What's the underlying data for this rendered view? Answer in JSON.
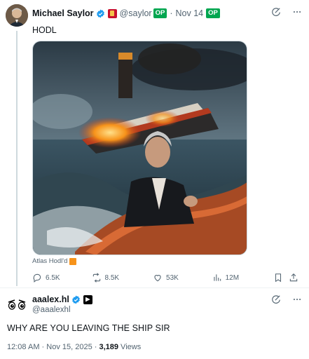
{
  "tweet1": {
    "author_name": "Michael Saylor",
    "handle": "@saylor",
    "op_badge": "OP",
    "date": "Nov 14",
    "date_op_badge": "OP",
    "text": "HODL",
    "media_caption": "Atlas Hodl'd",
    "stats": {
      "replies": "6.5K",
      "reposts": "8.5K",
      "likes": "53K",
      "views": "12M"
    }
  },
  "tweet2": {
    "author_name": "aaalex.hl",
    "handle": "@aaalexhl",
    "text": "WHY ARE YOU LEAVING THE SHIP SIR",
    "timestamp": "12:08 AM · Nov 15, 2025 · ",
    "views_count": "3,189",
    "views_label": " Views"
  },
  "icons": {
    "grok": "grok-icon",
    "more": "more-horizontal-icon",
    "reply": "reply-icon",
    "repost": "repost-icon",
    "like": "heart-icon",
    "views": "views-bar-chart-icon",
    "bookmark": "bookmark-icon",
    "share": "share-icon",
    "verified": "verified-check-icon"
  },
  "colors": {
    "verified_blue": "#1d9bf0",
    "op_green": "#00a650",
    "bitcoin_orange": "#f7931a",
    "muted_text": "#536471"
  }
}
